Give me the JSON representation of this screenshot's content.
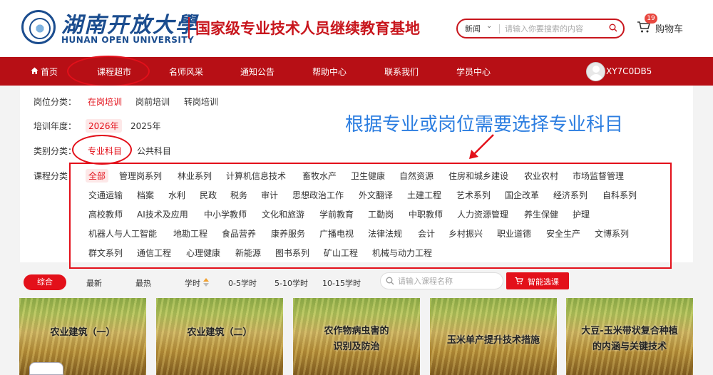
{
  "header": {
    "logo_cn": "湖南开放大學",
    "logo_en": "HUNAN OPEN UNIVERSITY",
    "slogan": "国家级专业技术人员继续教育基地",
    "search": {
      "category": "新闻",
      "placeholder": "请输入你要搜索的内容"
    },
    "cart": {
      "count": "19",
      "label": "购物车"
    }
  },
  "nav": {
    "items": [
      {
        "label": "首页"
      },
      {
        "label": "课程超市"
      },
      {
        "label": "名师风采"
      },
      {
        "label": "通知公告"
      },
      {
        "label": "帮助中心"
      },
      {
        "label": "联系我们"
      },
      {
        "label": "学员中心"
      }
    ],
    "user_id": "XY7C0DB5"
  },
  "filters": {
    "position": {
      "label": "岗位分类：",
      "options": [
        "在岗培训",
        "岗前培训",
        "转岗培训"
      ],
      "active": "在岗培训"
    },
    "year": {
      "label": "培训年度：",
      "options": [
        "2026年",
        "2025年"
      ],
      "active": "2026年"
    },
    "category": {
      "label": "类别分类：",
      "options": [
        "专业科目",
        "公共科目"
      ],
      "active": "专业科目"
    },
    "course": {
      "label": "课程分类：",
      "rows": [
        [
          "全部",
          "管理岗系列",
          "林业系列",
          "计算机信息技术",
          "畜牧水产",
          "卫生健康",
          "自然资源",
          "住房和城乡建设",
          "农业农村",
          "市场监督管理"
        ],
        [
          "交通运输",
          "档案",
          "水利",
          "民政",
          "税务",
          "审计",
          "思想政治工作",
          "外文翻译",
          "土建工程",
          "艺术系列",
          "国企改革",
          "经济系列",
          "自科系列"
        ],
        [
          "高校教师",
          "AI技术及应用",
          "中小学教师",
          "文化和旅游",
          "学前教育",
          "工勤岗",
          "中职教师",
          "人力资源管理",
          "养生保健",
          "护理"
        ],
        [
          "机器人与人工智能",
          "地勘工程",
          "食品营养",
          "康养服务",
          "广播电视",
          "法律法规",
          "会计",
          "乡村振兴",
          "职业道德",
          "安全生产",
          "文博系列"
        ],
        [
          "群文系列",
          "通信工程",
          "心理健康",
          "新能源",
          "图书系列",
          "矿山工程",
          "机械与动力工程"
        ]
      ],
      "active": "全部"
    }
  },
  "annotation": "根据专业或岗位需要选择专业科目",
  "sortbar": {
    "options": [
      "综合",
      "最新",
      "最热",
      "学时",
      "0-5学时",
      "5-10学时",
      "10-15学时"
    ],
    "active": "综合",
    "search_placeholder": "请输入课程名称",
    "smart_select": "智能选课"
  },
  "courses": [
    {
      "title_lines": [
        "农业建筑（一）"
      ]
    },
    {
      "title_lines": [
        "农业建筑（二）"
      ]
    },
    {
      "title_lines": [
        "农作物病虫害的",
        "识别及防治"
      ]
    },
    {
      "title_lines": [
        "玉米单产提升技术措施"
      ]
    },
    {
      "title_lines": [
        "大豆-玉米带状复合种植",
        "的内涵与关键技术"
      ]
    }
  ],
  "colors": {
    "brand_red": "#b70f15",
    "accent_red": "#e3101a",
    "logo_blue": "#1b4d8f",
    "annotation_blue": "#2b7de0"
  }
}
